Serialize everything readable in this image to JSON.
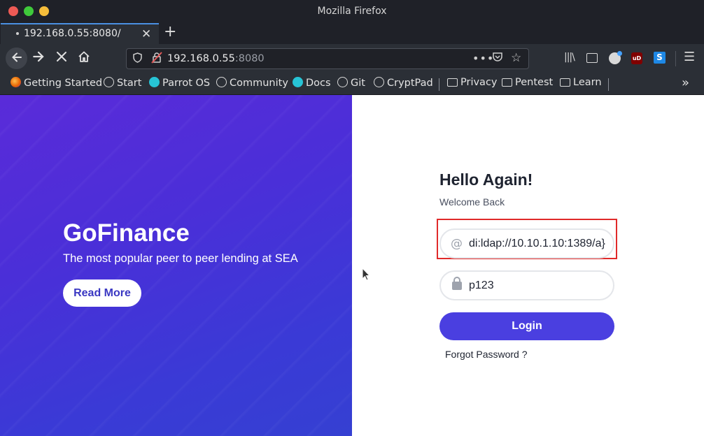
{
  "window": {
    "title": "Mozilla Firefox"
  },
  "tab": {
    "title": "192.168.0.55:8080/",
    "close_symbol": "✕",
    "new_tab_symbol": "+"
  },
  "urlbar": {
    "host": "192.168.0.55",
    "port": ":8080"
  },
  "bookmarks": [
    {
      "label": "Getting Started",
      "icon": "firefox-icon"
    },
    {
      "label": "Start",
      "icon": "globe-icon"
    },
    {
      "label": "Parrot OS",
      "icon": "parrot-icon"
    },
    {
      "label": "Community",
      "icon": "globe-icon"
    },
    {
      "label": "Docs",
      "icon": "parrot-icon"
    },
    {
      "label": "Git",
      "icon": "globe-icon"
    },
    {
      "label": "CryptPad",
      "icon": "globe-icon"
    },
    {
      "label": "Privacy",
      "icon": "folder-icon"
    },
    {
      "label": "Pentest",
      "icon": "folder-icon"
    },
    {
      "label": "Learn",
      "icon": "folder-icon"
    }
  ],
  "hero": {
    "title": "GoFinance",
    "subtitle": "The most popular peer to peer lending at SEA",
    "button": "Read More"
  },
  "login": {
    "title": "Hello Again!",
    "subtitle": "Welcome Back",
    "email_value": "di:ldap://10.10.1.10:1389/a}",
    "password_value": "p123",
    "button": "Login",
    "forgot": "Forgot Password ?"
  },
  "colors": {
    "hero_start": "#5a2bd9",
    "hero_end": "#3540d2",
    "login_button": "#4a3fe0",
    "highlight_box": "#e02a2a"
  }
}
